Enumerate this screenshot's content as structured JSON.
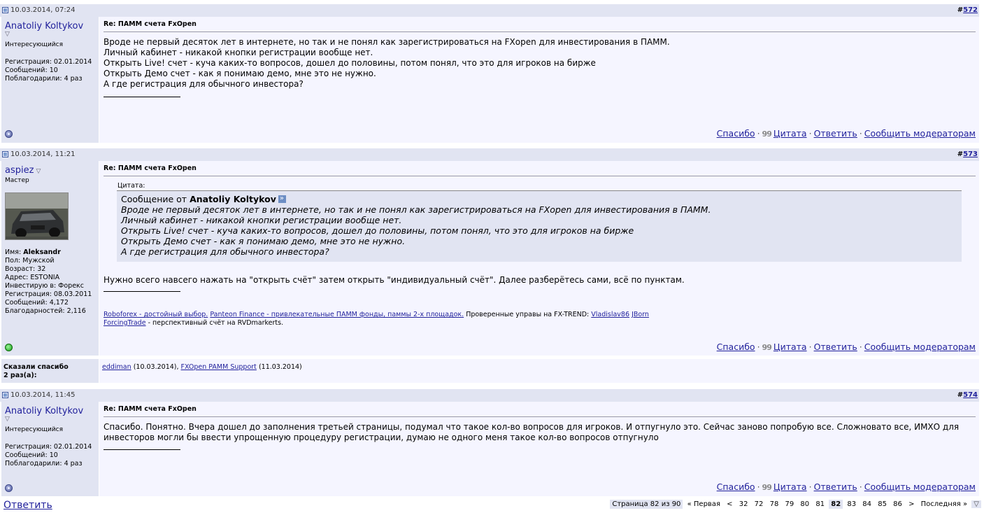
{
  "posts": [
    {
      "date": "10.03.2014, 07:24",
      "number": "572",
      "username": "Anatoliy Koltykov",
      "user_title": "Интересующийся",
      "info": [
        "Регистрация: 02.01.2014",
        "Сообщений: 10",
        "Поблагодарили: 4 раз"
      ],
      "online": false,
      "title": "Re: ПАММ счета FxOpen",
      "lines": [
        "Вроде не первый десяток лет в интернете, но так и не понял как зарегистрироваться на FXopen для инвестирования в ПАММ.",
        "Личный кабинет - никакой кнопки регистрации вообще нет.",
        "Открыть Live! счет - куча каких-то вопросов, дошел до половины, потом понял, что это для игроков на бирже",
        "Открыть Демо счет - как я понимаю демо, мне это не нужно.",
        "А где регистрация для обычного инвестора?"
      ]
    },
    {
      "date": "10.03.2014, 11:21",
      "number": "573",
      "username": "aspiez",
      "user_title": "Мастер",
      "info_name_label": "Имя:",
      "info_name_value": "Aleksandr",
      "info": [
        "Пол: Мужской",
        "Возраст: 32",
        "Адрес: ESTONIA",
        "Инвестирую в: Форекс",
        "Регистрация: 08.03.2011",
        "Сообщений: 4,172",
        "Благодарностей: 2,116"
      ],
      "online": true,
      "title": "Re: ПАММ счета FxOpen",
      "quote_label": "Цитата:",
      "quote_from_prefix": "Сообщение от",
      "quote_author": "Anatoliy Koltykov",
      "quote_lines": [
        "Вроде не первый десяток лет в интернете, но так и не понял как зарегистрироваться на FXopen для инвестирования в ПАММ.",
        "Личный кабинет - никакой кнопки регистрации вообще нет.",
        "Открыть Live! счет - куча каких-то вопросов, дошел до половины, потом понял, что это для игроков на бирже",
        "Открыть Демо счет - как я понимаю демо, мне это не нужно.",
        "А где регистрация для обычного инвестора?"
      ],
      "text": "Нужно всего навсего нажать на \"открыть счёт\" затем открыть \"индивидуальный счёт\". Далее разберётесь сами, всё по пунктам.",
      "sig": {
        "link1": "Roboforex - достойный выбор.",
        "link2": "Panteon Finance - привлекательные ПАММ фонды, паммы 2-х площадок.",
        "text1": "Проверенные управы на FX-TREND:",
        "link3": "Vladislav86",
        "link4": "JBorn",
        "link5": "ForcingTrade",
        "text2": "- перспективный счёт на RVDmarkerts."
      }
    },
    {
      "date": "10.03.2014, 11:45",
      "number": "574",
      "username": "Anatoliy Koltykov",
      "user_title": "Интересующийся",
      "info": [
        "Регистрация: 02.01.2014",
        "Сообщений: 10",
        "Поблагодарили: 4 раз"
      ],
      "online": false,
      "title": "Re: ПАММ счета FxOpen",
      "lines": [
        "Спасибо. Понятно. Вчера дошел до заполнения третьей страницы, подумал что такое кол-во вопросов для игроков. И отпугнуло это. Сейчас заново попробую все. Сложновато все, ИМХО для",
        "инвесторов могли бы ввести упрощенную процедуру регистрации, думаю не одного меня такое кол-во вопросов отпугнуло"
      ]
    }
  ],
  "actions": {
    "thanks": "Спасибо",
    "quote": "Цитата",
    "reply": "Ответить",
    "report": "Сообщить модераторам",
    "sep": "·"
  },
  "thanks_box": {
    "label_line1": "Сказали спасибо",
    "label_line2": "2 раз(а):",
    "user1": "eddiman",
    "date1": "(10.03.2014),",
    "user2": "FXOpen PAMM Support",
    "date2": "(11.03.2014)"
  },
  "footer": {
    "reply_button": "Ответить",
    "page_info": "Страница 82 из 90",
    "first": "« Первая",
    "prev": "<",
    "pages_before": [
      "32",
      "72",
      "78",
      "79",
      "80",
      "81"
    ],
    "current": "82",
    "pages_after": [
      "83",
      "84",
      "85",
      "86"
    ],
    "next": ">",
    "last": "Последняя »",
    "dropdown": "▽"
  },
  "colors": {
    "header_bg": "#e1e4f2",
    "body_bg": "#f5f5ff",
    "link": "#22229c"
  }
}
